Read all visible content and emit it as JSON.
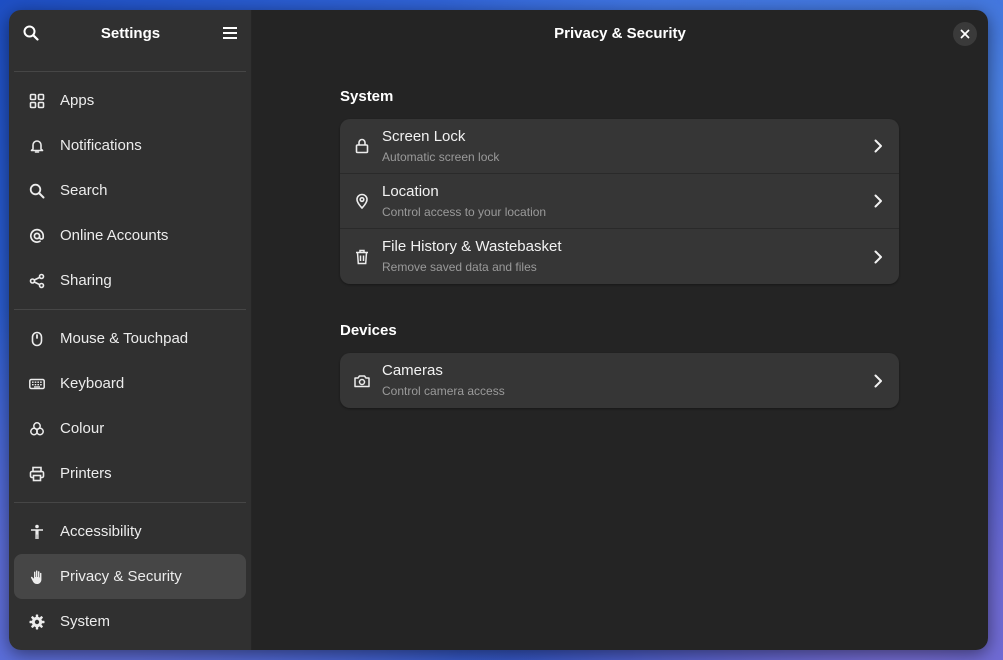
{
  "window": {
    "title": "Privacy & Security"
  },
  "sidebar": {
    "title": "Settings",
    "groups": [
      {
        "items": [
          {
            "label": "Apps",
            "icon": "apps-grid-icon"
          },
          {
            "label": "Notifications",
            "icon": "bell-icon"
          },
          {
            "label": "Search",
            "icon": "search-icon"
          },
          {
            "label": "Online Accounts",
            "icon": "at-sign-icon"
          },
          {
            "label": "Sharing",
            "icon": "share-icon"
          }
        ]
      },
      {
        "items": [
          {
            "label": "Mouse & Touchpad",
            "icon": "mouse-icon"
          },
          {
            "label": "Keyboard",
            "icon": "keyboard-icon"
          },
          {
            "label": "Colour",
            "icon": "colour-icon"
          },
          {
            "label": "Printers",
            "icon": "printer-icon"
          }
        ]
      },
      {
        "items": [
          {
            "label": "Accessibility",
            "icon": "accessibility-icon"
          },
          {
            "label": "Privacy & Security",
            "icon": "hand-icon",
            "selected": true
          },
          {
            "label": "System",
            "icon": "gear-icon"
          }
        ]
      }
    ]
  },
  "main": {
    "sections": [
      {
        "title": "System",
        "rows": [
          {
            "title": "Screen Lock",
            "subtitle": "Automatic screen lock",
            "icon": "lock-icon"
          },
          {
            "title": "Location",
            "subtitle": "Control access to your location",
            "icon": "location-pin-icon"
          },
          {
            "title": "File History & Wastebasket",
            "subtitle": "Remove saved data and files",
            "icon": "trash-icon"
          }
        ]
      },
      {
        "title": "Devices",
        "rows": [
          {
            "title": "Cameras",
            "subtitle": "Control camera access",
            "icon": "camera-icon"
          }
        ]
      }
    ]
  },
  "colors": {
    "accent_selected": "#464646",
    "sidebar_bg": "#303030",
    "content_bg": "#242424",
    "card_bg": "#363636"
  }
}
